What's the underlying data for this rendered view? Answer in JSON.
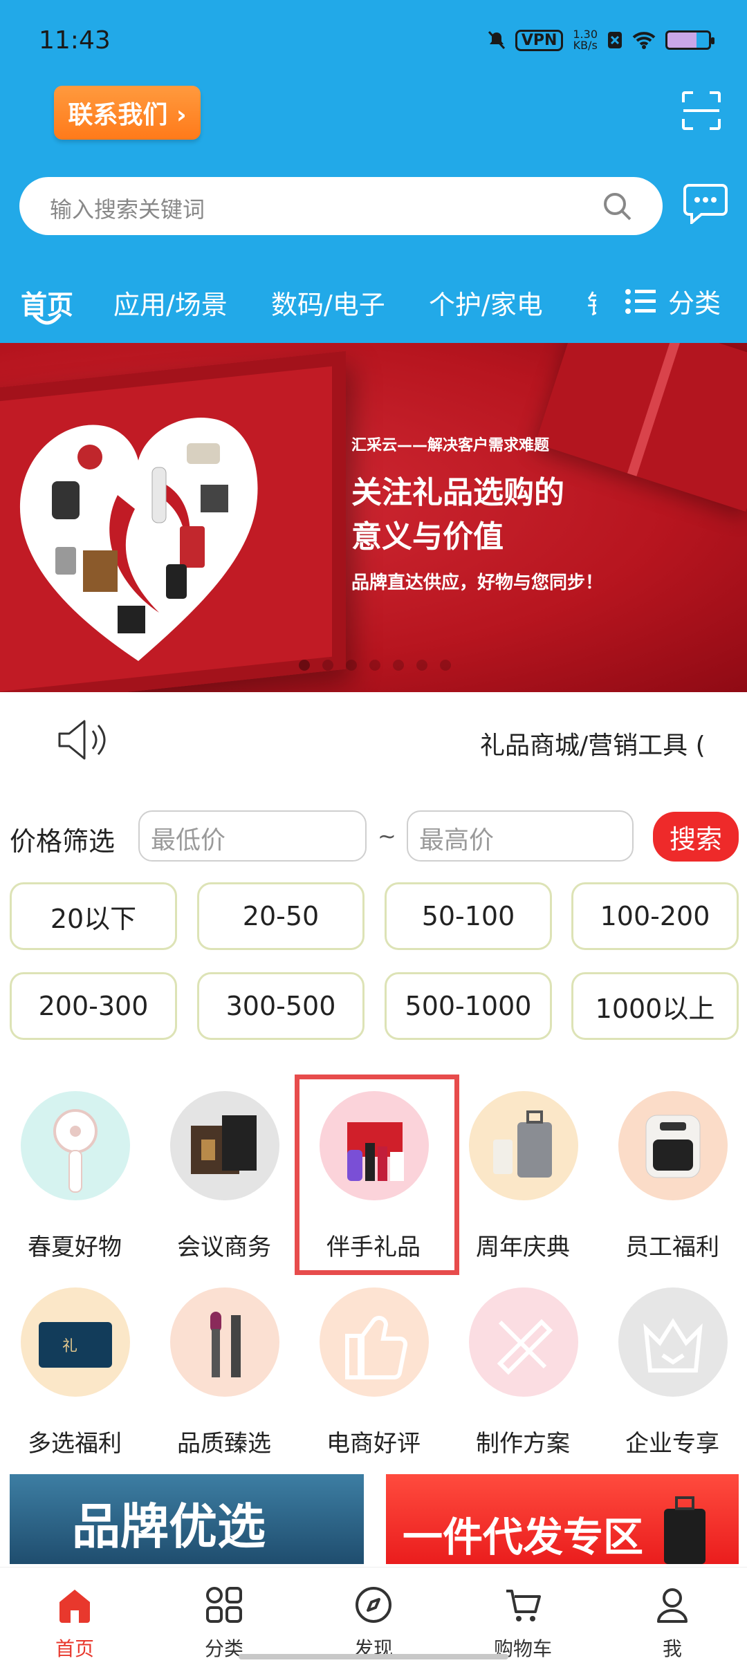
{
  "status_bar": {
    "time": "11:43",
    "vpn": "VPN",
    "speed_value": "1.30",
    "speed_unit": "KB/s"
  },
  "header": {
    "contact_label": "联系我们 ›",
    "search_placeholder": "输入搜索关键词",
    "tabs": [
      "首页",
      "应用/场景",
      "数码/电子",
      "个护/家电",
      "钅"
    ],
    "category_label": "分类"
  },
  "banner": {
    "line1": "汇采云——解决客户需求难题",
    "line2": "关注礼品选购的",
    "line3": "意义与价值",
    "line4": "品牌直达供应，好物与您同步！",
    "dot_count": 7,
    "active_dot": 0
  },
  "notice": {
    "text": "礼品商城/营销工具  ("
  },
  "price_filter": {
    "label": "价格筛选",
    "min_placeholder": "最低价",
    "separator": "~",
    "max_placeholder": "最高价",
    "search_label": "搜索",
    "ranges": [
      "20以下",
      "20-50",
      "50-100",
      "100-200",
      "200-300",
      "300-500",
      "500-1000",
      "1000以上"
    ]
  },
  "categories": [
    {
      "label": "春夏好物"
    },
    {
      "label": "会议商务"
    },
    {
      "label": "伴手礼品"
    },
    {
      "label": "周年庆典"
    },
    {
      "label": "员工福利"
    },
    {
      "label": "多选福利"
    },
    {
      "label": "品质臻选"
    },
    {
      "label": "电商好评"
    },
    {
      "label": "制作方案"
    },
    {
      "label": "企业专享"
    }
  ],
  "promos": {
    "left": "品牌优选",
    "right": "一件代发专区"
  },
  "bottom_nav": [
    {
      "label": "首页",
      "icon": "home-icon",
      "active": true
    },
    {
      "label": "分类",
      "icon": "grid-icon",
      "active": false
    },
    {
      "label": "发现",
      "icon": "compass-icon",
      "active": false
    },
    {
      "label": "购物车",
      "icon": "cart-icon",
      "active": false
    },
    {
      "label": "我",
      "icon": "user-icon",
      "active": false
    }
  ],
  "colors": {
    "header_bg": "#22a9e8",
    "accent_red": "#e8382d",
    "contact_orange": "#ff8a2a"
  }
}
